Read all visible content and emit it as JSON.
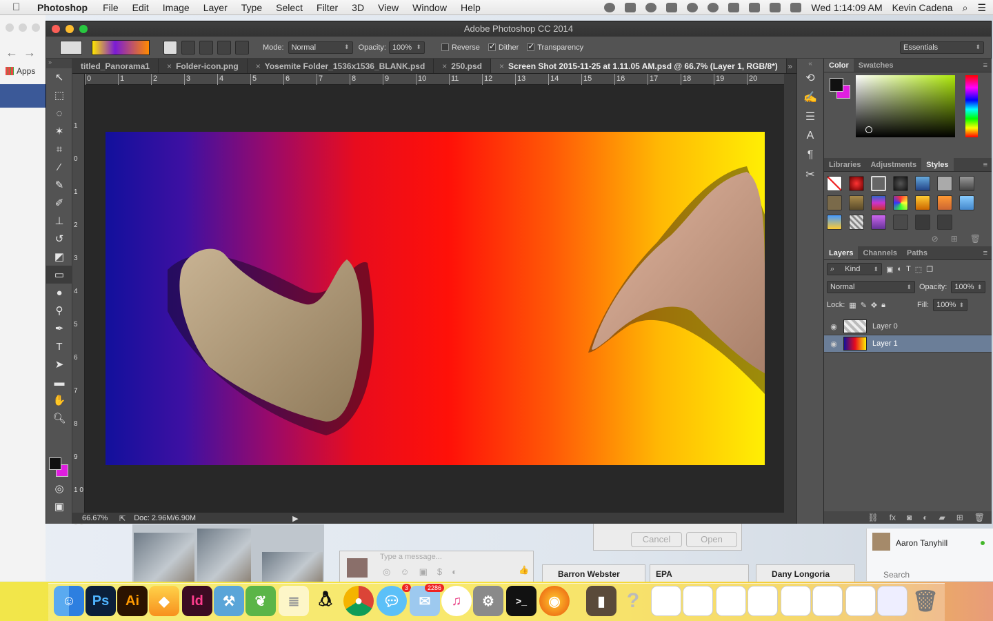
{
  "menubar": {
    "app_name": "Photoshop",
    "items": [
      "File",
      "Edit",
      "Image",
      "Layer",
      "Type",
      "Select",
      "Filter",
      "3D",
      "View",
      "Window",
      "Help"
    ],
    "clock": "Wed 1:14:09 AM",
    "user": "Kevin Cadena"
  },
  "browser": {
    "apps_label": "Apps"
  },
  "window": {
    "title": "Adobe Photoshop CC 2014"
  },
  "options": {
    "mode_label": "Mode:",
    "mode_value": "Normal",
    "opacity_label": "Opacity:",
    "opacity_value": "100%",
    "reverse_label": "Reverse",
    "dither_label": "Dither",
    "transparency_label": "Transparency",
    "workspace": "Essentials"
  },
  "tabs": [
    {
      "label": "titled_Panorama1",
      "close": false
    },
    {
      "label": "Folder-icon.png",
      "close": true
    },
    {
      "label": "Yosemite Folder_1536x1536_BLANK.psd",
      "close": true
    },
    {
      "label": "250.psd",
      "close": true
    },
    {
      "label": "Screen Shot 2015-11-25 at 1.11.05 AM.psd @ 66.7% (Layer 1, RGB/8*)",
      "close": true
    }
  ],
  "ruler_top": [
    "0",
    "1",
    "2",
    "3",
    "4",
    "5",
    "6",
    "7",
    "8",
    "9",
    "10",
    "11",
    "12",
    "13",
    "14",
    "15",
    "16",
    "17",
    "18",
    "19",
    "20"
  ],
  "ruler_left": [
    "1",
    "0",
    "1",
    "2",
    "3",
    "4",
    "5",
    "6",
    "7",
    "8",
    "9",
    "1 0",
    "1 1"
  ],
  "status": {
    "zoom": "66.67%",
    "doc": "Doc: 2.96M/6.90M"
  },
  "panels": {
    "color_tabs": [
      "Color",
      "Swatches"
    ],
    "style_tabs": [
      "Libraries",
      "Adjustments",
      "Styles"
    ],
    "layer_tabs": [
      "Layers",
      "Channels",
      "Paths"
    ],
    "kind_label": "Kind",
    "blend_mode": "Normal",
    "opacity_label": "Opacity:",
    "opacity_value": "100%",
    "lock_label": "Lock:",
    "fill_label": "Fill:",
    "fill_value": "100%"
  },
  "layers": [
    {
      "name": "Layer 0",
      "selected": false
    },
    {
      "name": "Layer 1",
      "selected": true
    }
  ],
  "background": {
    "cancel": "Cancel",
    "open": "Open",
    "message_placeholder": "Type a message...",
    "chat_tabs": [
      "Barron Webster",
      "EPA",
      "Dany Longoria"
    ],
    "contact": "Aaron Tanyhill",
    "search_placeholder": "Search"
  },
  "dock": {
    "ps_label": "Ps",
    "ai_label": "Ai",
    "id_label": "Id",
    "messages_badge": "3",
    "mail_badge": "2286"
  },
  "colors": {
    "accent_selected_layer": "#6b7e98",
    "foreground": "#111111",
    "background": "#e01ee0"
  }
}
